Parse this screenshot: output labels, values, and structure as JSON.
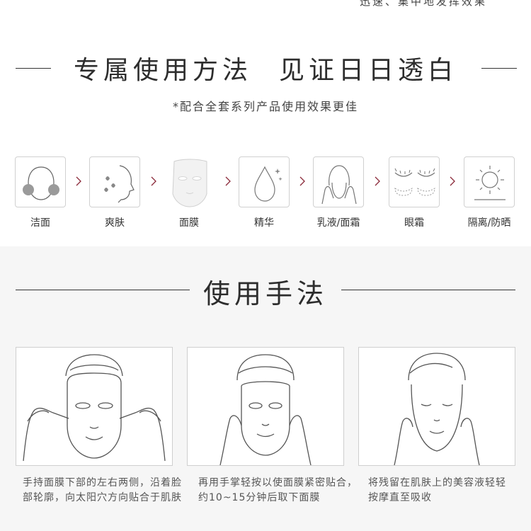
{
  "top_text": "迅速、集中地发挥效果",
  "headline1": {
    "left": "专属使用方法",
    "right": "见证日日透白"
  },
  "subtitle1": "*配合全套系列产品使用效果更佳",
  "steps": [
    {
      "label": "洁面",
      "icon": "face-cleanse-icon"
    },
    {
      "label": "爽肤",
      "icon": "toner-face-icon"
    },
    {
      "label": "面膜",
      "icon": "sheet-mask-icon"
    },
    {
      "label": "精华",
      "icon": "serum-drop-icon"
    },
    {
      "label": "乳液/面霜",
      "icon": "cream-face-icon"
    },
    {
      "label": "眼霜",
      "icon": "eye-cream-icon"
    },
    {
      "label": "隔离/防晒",
      "icon": "sun-icon"
    }
  ],
  "headline2": "使用手法",
  "instructions": [
    {
      "text": "手持面膜下部的左右两侧，沿着脸部轮廓，向太阳穴方向贴合于肌肤"
    },
    {
      "text": "再用手掌轻按以使面膜紧密贴合，约10~15分钟后取下面膜"
    },
    {
      "text": "将残留在肌肤上的美容液轻轻按摩直至吸收"
    }
  ],
  "colors": {
    "accent_arrow": "#8b2a3a",
    "line_art": "#555555",
    "section_bg": "#f6f6f6"
  }
}
